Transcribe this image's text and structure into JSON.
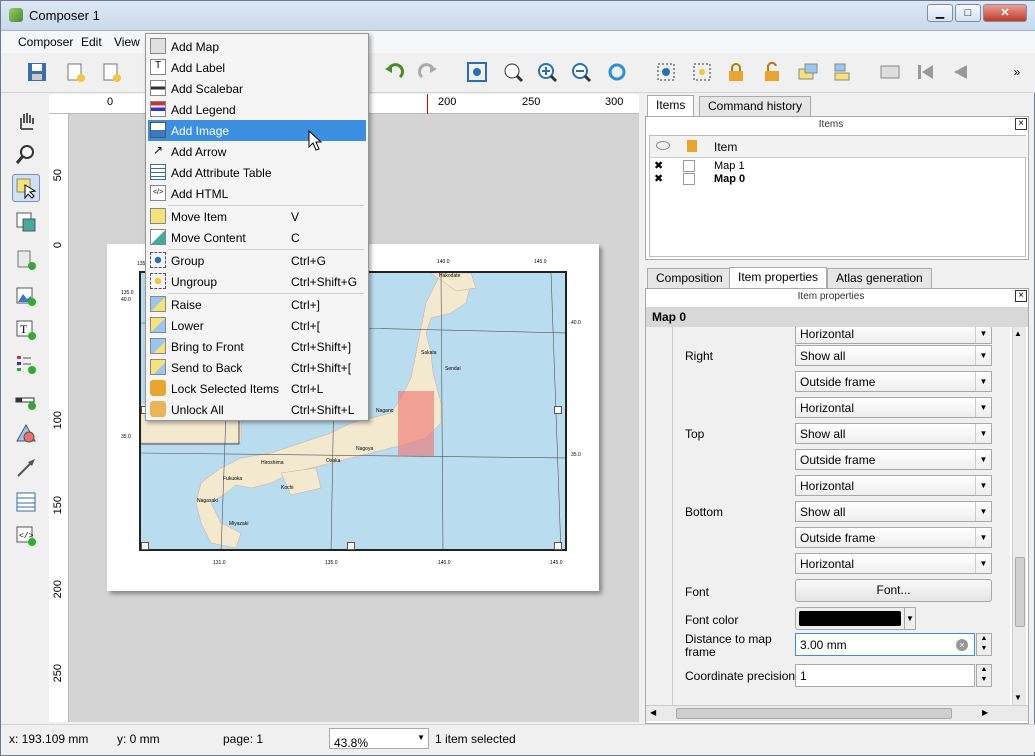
{
  "window": {
    "title": "Composer 1",
    "minimize": "▁",
    "maximize": "□",
    "close": "✕"
  },
  "menubar": {
    "composer": "Composer",
    "edit": "Edit",
    "view": "View"
  },
  "ruler": {
    "h": [
      "0",
      "200",
      "250",
      "300"
    ],
    "v": [
      "50",
      "0",
      "50",
      "100",
      "150",
      "200",
      "250"
    ]
  },
  "map": {
    "top_ticks": [
      "135.0",
      "140.0",
      "145.0"
    ],
    "bottom_ticks": [
      "131.0",
      "135.0",
      "140.0",
      "145.0"
    ],
    "left_ticks": [
      "135.0",
      "40.0",
      "35.0"
    ],
    "right_ticks": [
      "40.0",
      "35.0"
    ],
    "cities": [
      "Hakodate",
      "Sakata",
      "Sendai",
      "Niigata",
      "Nagano",
      "Nagoya",
      "Osaka",
      "Hiroshima",
      "Kochi",
      "Fukuoka",
      "Nagasaki",
      "Miyazaki"
    ]
  },
  "menu": {
    "items": [
      {
        "label": "Add Map",
        "shortcut": ""
      },
      {
        "label": "Add Label",
        "shortcut": ""
      },
      {
        "label": "Add Scalebar",
        "shortcut": ""
      },
      {
        "label": "Add Legend",
        "shortcut": ""
      },
      {
        "label": "Add Image",
        "shortcut": ""
      },
      {
        "label": "Add Arrow",
        "shortcut": ""
      },
      {
        "label": "Add Attribute Table",
        "shortcut": ""
      },
      {
        "label": "Add HTML",
        "shortcut": ""
      },
      {
        "label": "Move Item",
        "shortcut": "V"
      },
      {
        "label": "Move Content",
        "shortcut": "C"
      },
      {
        "label": "Group",
        "shortcut": "Ctrl+G"
      },
      {
        "label": "Ungroup",
        "shortcut": "Ctrl+Shift+G"
      },
      {
        "label": "Raise",
        "shortcut": "Ctrl+]"
      },
      {
        "label": "Lower",
        "shortcut": "Ctrl+["
      },
      {
        "label": "Bring to Front",
        "shortcut": "Ctrl+Shift+]"
      },
      {
        "label": "Send to Back",
        "shortcut": "Ctrl+Shift+["
      },
      {
        "label": "Lock Selected Items",
        "shortcut": "Ctrl+L"
      },
      {
        "label": "Unlock All",
        "shortcut": "Ctrl+Shift+L"
      }
    ]
  },
  "right_panel": {
    "top_tabs": [
      "Items",
      "Command history"
    ],
    "items_header": "Items",
    "items_col": "Item",
    "items": [
      {
        "name": "Map 1",
        "visible": "✖"
      },
      {
        "name": "Map 0",
        "visible": "✖"
      }
    ],
    "bottom_tabs": [
      "Composition",
      "Item properties",
      "Atlas generation"
    ],
    "props_header": "Item properties",
    "item_title": "Map 0",
    "labels": {
      "right": "Right",
      "top": "Top",
      "bottom": "Bottom",
      "font": "Font",
      "font_color": "Font color",
      "distance": "Distance to map frame",
      "precision": "Coordinate precision"
    },
    "combos": [
      "Horizontal",
      "Show all",
      "Outside frame",
      "Horizontal",
      "Show all",
      "Outside frame",
      "Horizontal",
      "Show all",
      "Outside frame",
      "Horizontal"
    ],
    "font_button": "Font...",
    "distance_value": "3.00 mm",
    "precision_value": "1"
  },
  "status": {
    "x": "x: 193.109 mm",
    "y": "y: 0 mm",
    "page": "page: 1",
    "zoom": "43.8%",
    "selection": "1 item selected"
  },
  "colors": {
    "highlight": "#3b8ee0",
    "map_water": "#b9dcef",
    "land": "#f2e9cf",
    "selection": "#f08070"
  }
}
